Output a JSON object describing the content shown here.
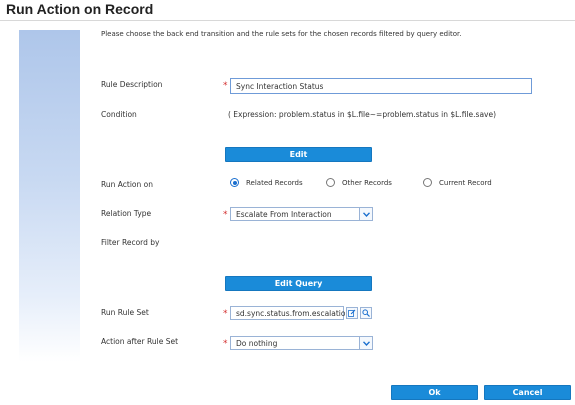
{
  "dialog": {
    "title": "Run Action on Record",
    "instructions": "Please choose the back end transition and the rule sets for the chosen records filtered by query editor."
  },
  "form": {
    "rule_description": {
      "label": "Rule Description",
      "value": "Sync Interaction Status",
      "required": true
    },
    "condition": {
      "label": "Condition",
      "expression": "( Expression: problem.status in $L.file~=problem.status in $L.file.save)"
    },
    "edit_button": "Edit",
    "run_action_on": {
      "label": "Run Action on",
      "options": [
        "Related Records",
        "Other Records",
        "Current Record"
      ],
      "selected": "Related Records"
    },
    "relation_type": {
      "label": "Relation Type",
      "value": "Escalate From Interaction",
      "required": true
    },
    "filter_record_by": {
      "label": "Filter Record by"
    },
    "edit_query_button": "Edit Query",
    "run_rule_set": {
      "label": "Run Rule Set",
      "value": "sd.sync.status.from.escalation",
      "required": true
    },
    "action_after_rule_set": {
      "label": "Action after Rule Set",
      "value": "Do nothing",
      "required": true
    }
  },
  "footer": {
    "ok_label": "Ok",
    "cancel_label": "Cancel"
  },
  "icons": {
    "chevron": "chevron-down-icon",
    "edit_file": "edit-file-icon",
    "search": "search-icon"
  },
  "colors": {
    "accent": "#1a8bd9",
    "required_marker": "#d32f2f",
    "input_border": "#6f9bd8"
  }
}
